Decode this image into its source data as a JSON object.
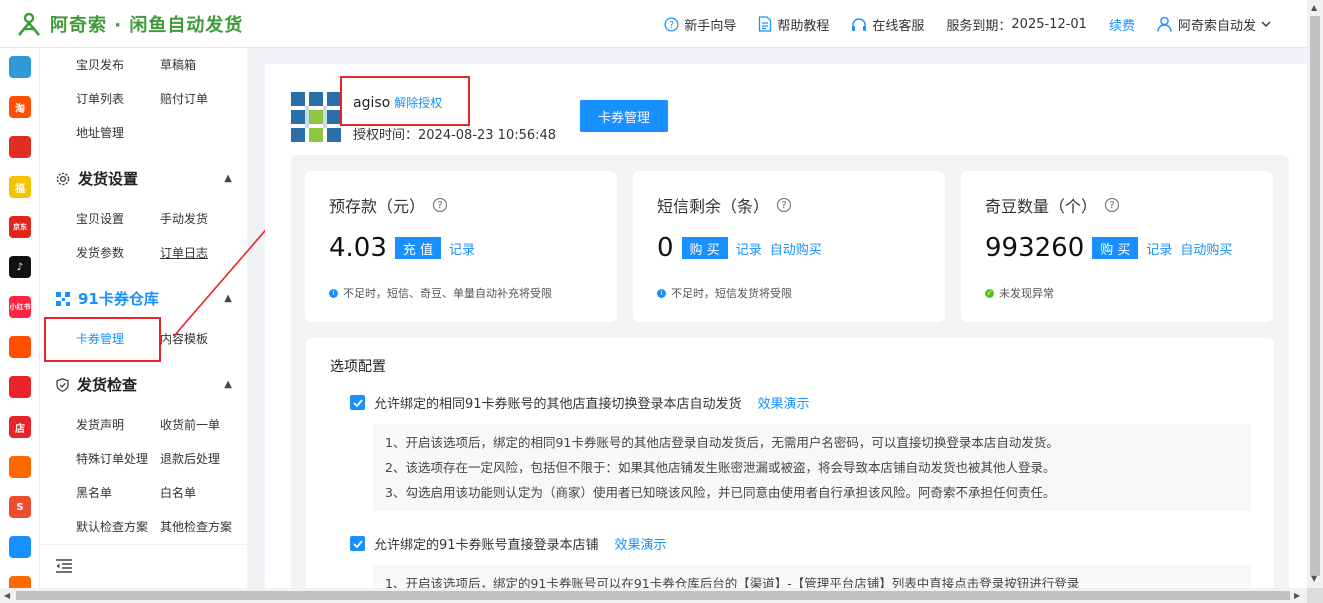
{
  "app": {
    "title": "阿奇索 · 闲鱼自动发货",
    "brand_color": "#3f9b3a",
    "accent_color": "#1890ff",
    "highlight_color": "#e8242a"
  },
  "header": {
    "guide": "新手向导",
    "tutorial": "帮助教程",
    "support": "在线客服",
    "service_label": "服务到期：",
    "service_date": "2025-12-01",
    "renew": "续费",
    "user": "阿奇索自动发",
    "icons": [
      "question-circle-icon",
      "document-icon",
      "headset-icon",
      "user-icon",
      "chevron-down-icon"
    ]
  },
  "rail": {
    "items": [
      {
        "name": "qr-app-icon",
        "text": "",
        "color": "#2f9ad8"
      },
      {
        "name": "taobao-icon",
        "text": "淘",
        "color": "#ff5000"
      },
      {
        "name": "pinduoduo-icon",
        "text": "",
        "color": "#e02e24"
      },
      {
        "name": "fuli-icon",
        "text": "福",
        "color": "#f5c400"
      },
      {
        "name": "jd-icon",
        "text": "京东",
        "color": "#e1251b"
      },
      {
        "name": "douyin-icon",
        "text": "♪",
        "color": "#111111"
      },
      {
        "name": "xiaohongshu-icon",
        "text": "小红书",
        "color": "#ff2442"
      },
      {
        "name": "kuaishou-icon",
        "text": "",
        "color": "#ff5000"
      },
      {
        "name": "thumb-icon",
        "text": "",
        "color": "#e8242a"
      },
      {
        "name": "dian-icon",
        "text": "店",
        "color": "#e8242a"
      },
      {
        "name": "bag-icon",
        "text": "",
        "color": "#ff6a00"
      },
      {
        "name": "shopee-icon",
        "text": "S",
        "color": "#ee4d2d"
      },
      {
        "name": "link-icon",
        "text": "",
        "color": "#1890ff"
      },
      {
        "name": "more-icon",
        "text": "",
        "color": "#ff6a00"
      }
    ]
  },
  "menu": {
    "top_items": [
      "宝贝发布",
      "草稿箱",
      "订单列表",
      "赔付订单",
      "地址管理"
    ],
    "groups": [
      {
        "title": "发货设置",
        "items": [
          "宝贝设置",
          "手动发货",
          "发货参数",
          "订单日志"
        ]
      },
      {
        "title": "91卡券仓库",
        "items": [
          "卡券管理",
          "内容模板"
        ]
      },
      {
        "title": "发货检查",
        "items": [
          "发货声明",
          "收货前一单",
          "特殊订单处理",
          "退款后处理",
          "黑名单",
          "白名单",
          "默认检查方案",
          "其他检查方案"
        ]
      }
    ],
    "collapse_icon": "menu-collapse-icon"
  },
  "account": {
    "name": "agiso",
    "unbind": "解除授权",
    "auth_time": "授权时间：2024-08-23 10:56:48",
    "manage_button": "卡券管理"
  },
  "stats": [
    {
      "label": "预存款（元）",
      "value": "4.03",
      "button": "充 值",
      "links": [
        "记录"
      ],
      "note": "不足时，短信、奇豆、单量自动补充将受限",
      "note_type": "info"
    },
    {
      "label": "短信剩余（条）",
      "value": "0",
      "button": "购 买",
      "links": [
        "记录",
        "自动购买"
      ],
      "note": "不足时，短信发货将受限",
      "note_type": "info"
    },
    {
      "label": "奇豆数量（个）",
      "value": "993260",
      "button": "购 买",
      "links": [
        "记录",
        "自动购买"
      ],
      "note": "未发现异常",
      "note_type": "ok"
    }
  ],
  "options": {
    "title": "选项配置",
    "items": [
      {
        "label": "允许绑定的相同91卡券账号的其他店直接切换登录本店自动发货",
        "checked": true,
        "demo": "效果演示",
        "desc": [
          "1、开启该选项后，绑定的相同91卡券账号的其他店登录自动发货后，无需用户名密码，可以直接切换登录本店自动发货。",
          "2、该选项存在一定风险，包括但不限于：如果其他店铺发生账密泄漏或被盗，将会导致本店铺自动发货也被其他人登录。",
          "3、勾选启用该功能则认定为（商家）使用者已知晓该风险，并已同意由使用者自行承担该风险。阿奇索不承担任何责任。"
        ]
      },
      {
        "label": "允许绑定的91卡券账号直接登录本店铺",
        "checked": true,
        "demo": "效果演示",
        "desc": [
          "1、开启该选项后，绑定的91卡券账号可以在91卡券仓库后台的【渠道】-【管理平台店铺】列表中直接点击登录按钮进行登录"
        ]
      }
    ]
  }
}
